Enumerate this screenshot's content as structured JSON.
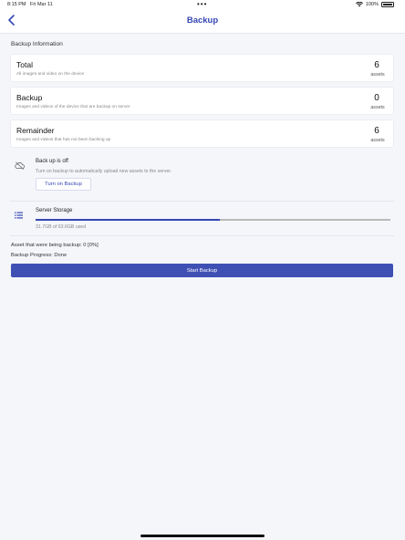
{
  "status_bar": {
    "time": "8:15 PM",
    "date": "Fri Mar 11",
    "battery": "100%"
  },
  "nav": {
    "title": "Backup"
  },
  "section": {
    "header": "Backup Information"
  },
  "cards": [
    {
      "title": "Total",
      "description": "All images and video on the device",
      "count": "6",
      "unit": "assets"
    },
    {
      "title": "Backup",
      "description": "Images and videos of the device that are backup on server",
      "count": "0",
      "unit": "assets"
    },
    {
      "title": "Remainder",
      "description": "Images and videos that has not been backing up",
      "count": "6",
      "unit": "assets"
    }
  ],
  "backup_status": {
    "title": "Back up is off",
    "description": "Turn on backup to automatically upload new assets to the server.",
    "button_label": "Turn on Backup"
  },
  "server_storage": {
    "title": "Server Storage",
    "used_text": "31.7GB of 63.6GB used",
    "used_fraction": 0.52
  },
  "progress": {
    "asset_line": "Asset that were being backup: 0 [0%]",
    "progress_line": "Backup Progress: Done"
  },
  "actions": {
    "start_label": "Start Backup"
  },
  "colors": {
    "accent": "#3446b3",
    "button": "#3f50b5",
    "background": "#f5f6fa"
  }
}
